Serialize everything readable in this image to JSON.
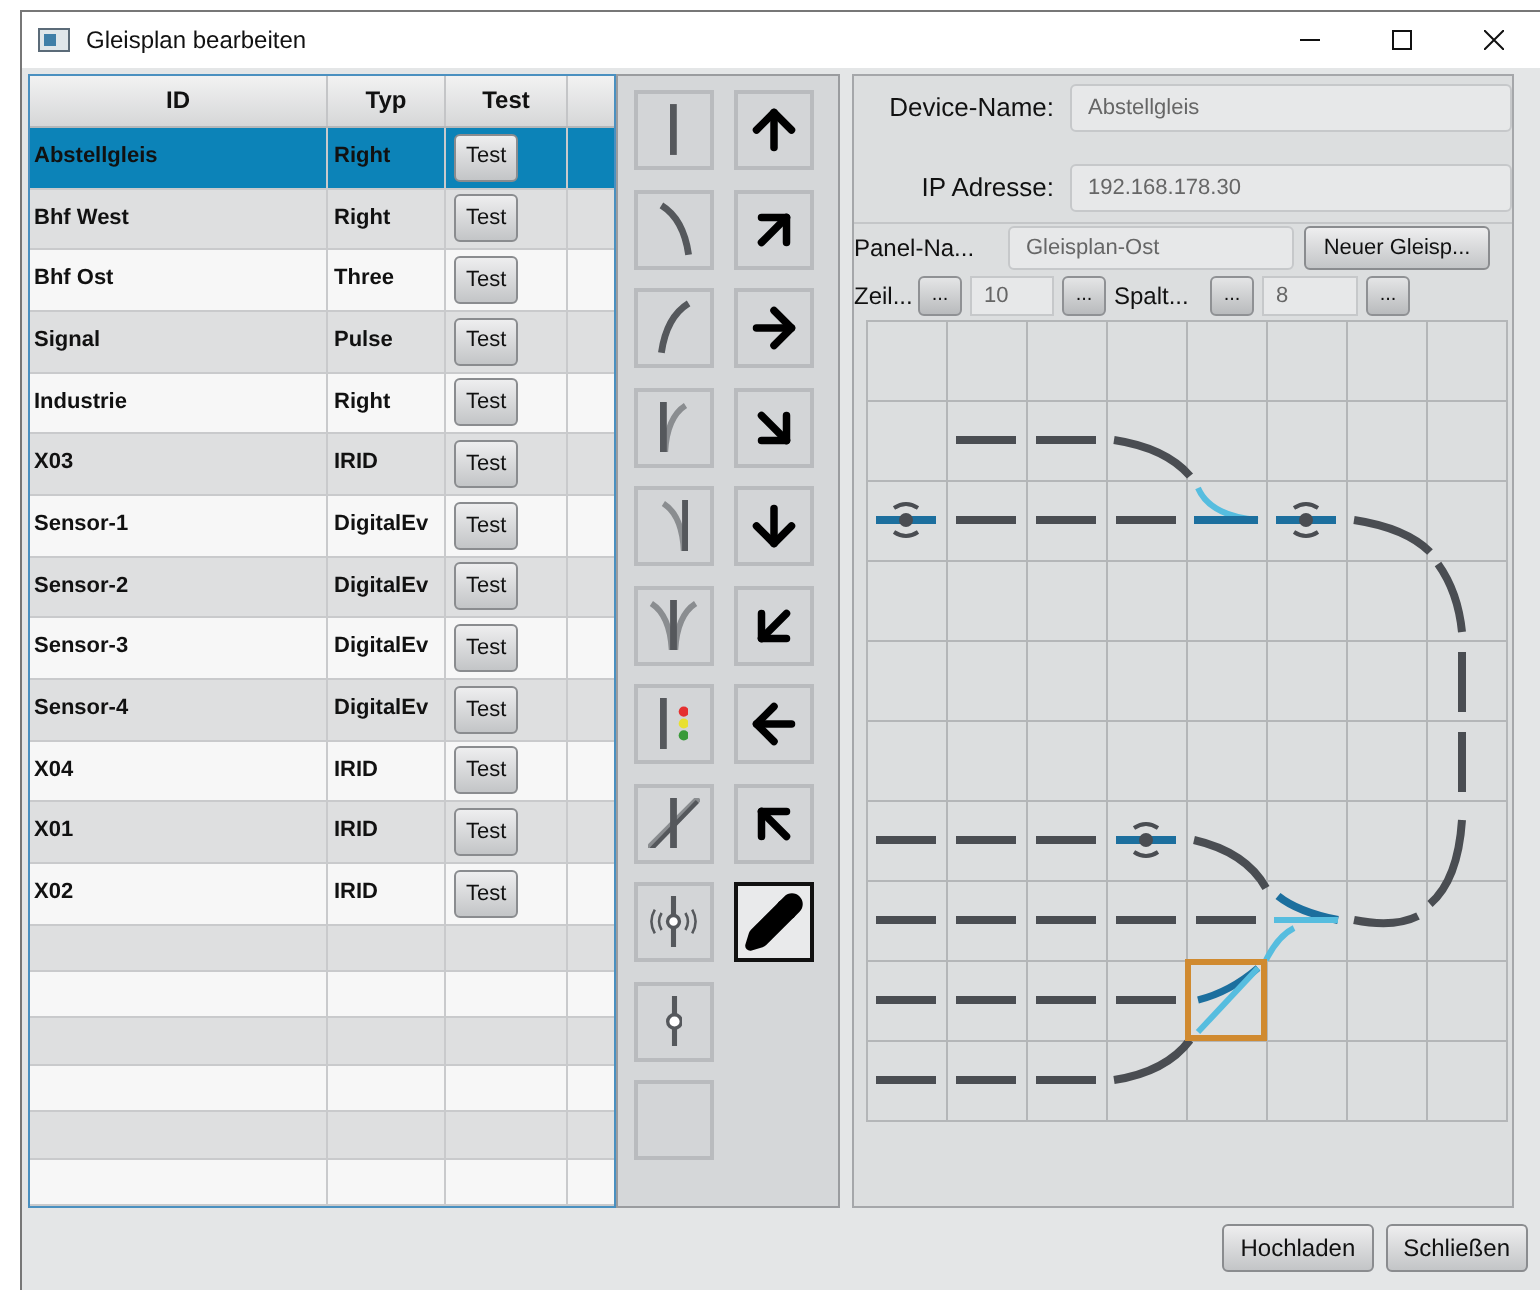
{
  "window": {
    "title": "Gleisplan bearbeiten"
  },
  "table": {
    "columns": [
      "ID",
      "Typ",
      "Test"
    ],
    "rows": [
      {
        "id": "Abstellgleis",
        "typ": "Right",
        "test": "Test",
        "selected": true
      },
      {
        "id": "Bhf West",
        "typ": "Right",
        "test": "Test",
        "selected": false
      },
      {
        "id": "Bhf Ost",
        "typ": "Three",
        "test": "Test",
        "selected": false
      },
      {
        "id": "Signal",
        "typ": "Pulse",
        "test": "Test",
        "selected": false
      },
      {
        "id": "Industrie",
        "typ": "Right",
        "test": "Test",
        "selected": false
      },
      {
        "id": "X03",
        "typ": "IRID",
        "test": "Test",
        "selected": false
      },
      {
        "id": "Sensor-1",
        "typ": "DigitalEv",
        "test": "Test",
        "selected": false
      },
      {
        "id": "Sensor-2",
        "typ": "DigitalEv",
        "test": "Test",
        "selected": false
      },
      {
        "id": "Sensor-3",
        "typ": "DigitalEv",
        "test": "Test",
        "selected": false
      },
      {
        "id": "Sensor-4",
        "typ": "DigitalEv",
        "test": "Test",
        "selected": false
      },
      {
        "id": "X04",
        "typ": "IRID",
        "test": "Test",
        "selected": false
      },
      {
        "id": "X01",
        "typ": "IRID",
        "test": "Test",
        "selected": false
      },
      {
        "id": "X02",
        "typ": "IRID",
        "test": "Test",
        "selected": false
      }
    ]
  },
  "palette": {
    "track_tools": [
      {
        "kind": "straight",
        "selected": false
      },
      {
        "kind": "curve-left",
        "selected": false
      },
      {
        "kind": "curve-right",
        "selected": false
      },
      {
        "kind": "switch-right",
        "selected": false
      },
      {
        "kind": "switch-left",
        "selected": false
      },
      {
        "kind": "switch-three",
        "selected": false
      },
      {
        "kind": "signal",
        "selected": false
      },
      {
        "kind": "crossing",
        "selected": false
      },
      {
        "kind": "sensor",
        "selected": false
      },
      {
        "kind": "contact",
        "selected": false
      },
      {
        "kind": "empty",
        "selected": false
      }
    ],
    "direction_tools": [
      {
        "kind": "up",
        "selected": false
      },
      {
        "kind": "up-right",
        "selected": false
      },
      {
        "kind": "right",
        "selected": false
      },
      {
        "kind": "down-right",
        "selected": false
      },
      {
        "kind": "down",
        "selected": false
      },
      {
        "kind": "down-left",
        "selected": false
      },
      {
        "kind": "left",
        "selected": false
      },
      {
        "kind": "up-left",
        "selected": false
      },
      {
        "kind": "pencil",
        "selected": true
      }
    ]
  },
  "device": {
    "name_label": "Device-Name:",
    "name_value": "Abstellgleis",
    "ip_label": "IP Adresse:",
    "ip_value": "192.168.178.30"
  },
  "panel": {
    "name_label": "Panel-Na...",
    "name_value": "Gleisplan-Ost",
    "new_button": "Neuer Gleisp...",
    "rows_label": "Zeil...",
    "rows_value": "10",
    "cols_label": "Spalt...",
    "cols_value": "8",
    "more_button": "..."
  },
  "buttons": [
    "Hochladen",
    "Schließen"
  ]
}
